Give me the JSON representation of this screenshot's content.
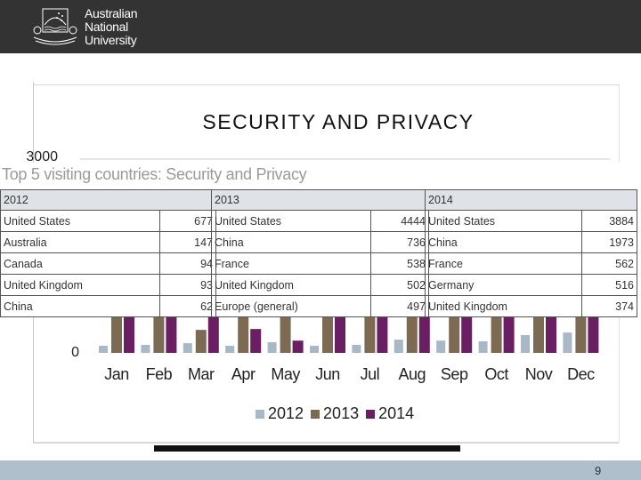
{
  "header": {
    "logo_lines": [
      "Australian",
      "National",
      "University"
    ],
    "background": "#333333"
  },
  "slide": {
    "page_number": "9"
  },
  "chart_data": {
    "type": "bar",
    "title": "SECURITY AND PRIVACY",
    "categories": [
      "Jan",
      "Feb",
      "Mar",
      "Apr",
      "May",
      "Jun",
      "Jul",
      "Aug",
      "Sep",
      "Oct",
      "Nov",
      "Dec"
    ],
    "y_ticks_visible": [
      "3000",
      "0"
    ],
    "ylim": [
      0,
      3000
    ],
    "grid": true,
    "legend_position": "bottom",
    "note_hidden_values": "values above ~400 are hidden behind the overlaid table",
    "series": [
      {
        "name": "2012",
        "color": "#a9b8c6",
        "values": [
          110,
          125,
          150,
          110,
          165,
          110,
          125,
          205,
          190,
          180,
          275,
          315
        ]
      },
      {
        "name": "2013",
        "color": "#7d6a52",
        "values": [
          null,
          null,
          356,
          null,
          null,
          null,
          null,
          null,
          null,
          null,
          null,
          null
        ]
      },
      {
        "name": "2014",
        "color": "#6a1f62",
        "values": [
          null,
          null,
          null,
          370,
          190,
          null,
          null,
          null,
          null,
          null,
          null,
          null
        ]
      }
    ]
  },
  "overlay": {
    "title": "Top 5 visiting countries: Security and Privacy",
    "tables": [
      {
        "year": "2012",
        "rows": [
          [
            "United States",
            "677"
          ],
          [
            "Australia",
            "147"
          ],
          [
            "Canada",
            "94"
          ],
          [
            "United Kingdom",
            "93"
          ],
          [
            "China",
            "62"
          ]
        ]
      },
      {
        "year": "2013",
        "rows": [
          [
            "United States",
            "4444"
          ],
          [
            "China",
            "736"
          ],
          [
            "France",
            "538"
          ],
          [
            "United Kingdom",
            "502"
          ],
          [
            "Europe (general)",
            "497"
          ]
        ]
      },
      {
        "year": "2014",
        "rows": [
          [
            "United States",
            "3884"
          ],
          [
            "China",
            "1973"
          ],
          [
            "France",
            "562"
          ],
          [
            "Germany",
            "516"
          ],
          [
            "United Kingdom",
            "374"
          ]
        ]
      }
    ]
  }
}
